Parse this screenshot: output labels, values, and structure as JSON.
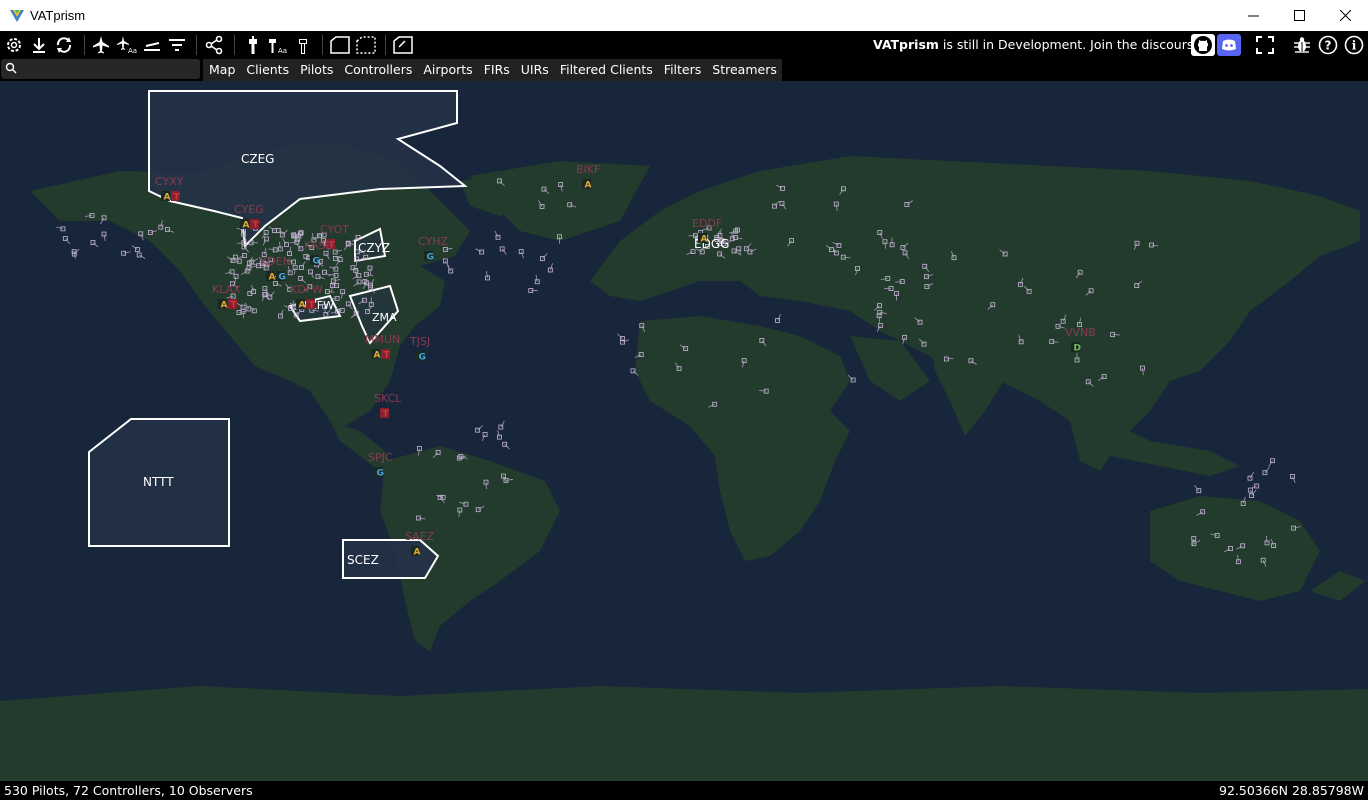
{
  "window": {
    "title": "VATprism"
  },
  "toolbar": {
    "announcement_brand": "VATprism",
    "announcement_text": "is still in Development. Join the discourse!",
    "icons": [
      "settings-icon",
      "download-icon",
      "refresh-icon",
      "airplane-icon",
      "airplane-label-icon",
      "runway-icon",
      "filter-lines-icon",
      "share-icon",
      "tower-icon",
      "tower-label-icon",
      "tower-outline-icon",
      "fir-shape-icon",
      "fir-dashed-icon",
      "uir-shape-icon",
      "github-icon",
      "discord-icon",
      "fullscreen-icon",
      "bug-icon",
      "help-icon",
      "info-icon"
    ]
  },
  "search": {
    "placeholder": ""
  },
  "tabs": [
    "Map",
    "Clients",
    "Pilots",
    "Controllers",
    "Airports",
    "FIRs",
    "UIRs",
    "Filtered Clients",
    "Filters",
    "Streamers"
  ],
  "map": {
    "colors": {
      "ocean": "#17263b",
      "land": "#223b2c",
      "fir_outline": "#ffffff",
      "fir_fill": "#233248",
      "airport_label": "#8a3a52",
      "atc_badge": "#c83a3a"
    },
    "firs": [
      {
        "id": "CZEG",
        "label": "CZEG"
      },
      {
        "id": "NTTT",
        "label": "NTTT"
      },
      {
        "id": "SCEZ",
        "label": "SCEZ"
      },
      {
        "id": "CZYZ",
        "label": "CZYZ"
      },
      {
        "id": "KZFW",
        "label": "KZFW"
      },
      {
        "id": "EDGG",
        "label": "EDGG"
      },
      {
        "id": "ZMA",
        "label": "ZMA"
      }
    ],
    "airports": [
      {
        "icao": "CYXY",
        "badges": "AT"
      },
      {
        "icao": "CYEG",
        "badges": "AT"
      },
      {
        "icao": "CYOT",
        "badges": "T"
      },
      {
        "icao": "KASE",
        "badges": "G"
      },
      {
        "icao": "KDEN",
        "badges": "AG"
      },
      {
        "icao": "KLAX",
        "badges": "AT"
      },
      {
        "icao": "KDFW",
        "badges": "AT"
      },
      {
        "icao": "CYHZ",
        "badges": "G"
      },
      {
        "icao": "TJSJ",
        "badges": "G"
      },
      {
        "icao": "BIKF",
        "badges": "A"
      },
      {
        "icao": "EDDF",
        "badges": "A"
      },
      {
        "icao": "VVNB",
        "badges": "D"
      },
      {
        "icao": "SKCL",
        "badges": "T"
      },
      {
        "icao": "SPJC",
        "badges": "G"
      },
      {
        "icao": "SAEZ",
        "badges": "A"
      },
      {
        "icao": "MMUN",
        "badges": "AT"
      }
    ]
  },
  "status": {
    "counts": "530 Pilots, 72 Controllers, 10 Observers",
    "coords": "92.50366N 28.85798W"
  }
}
